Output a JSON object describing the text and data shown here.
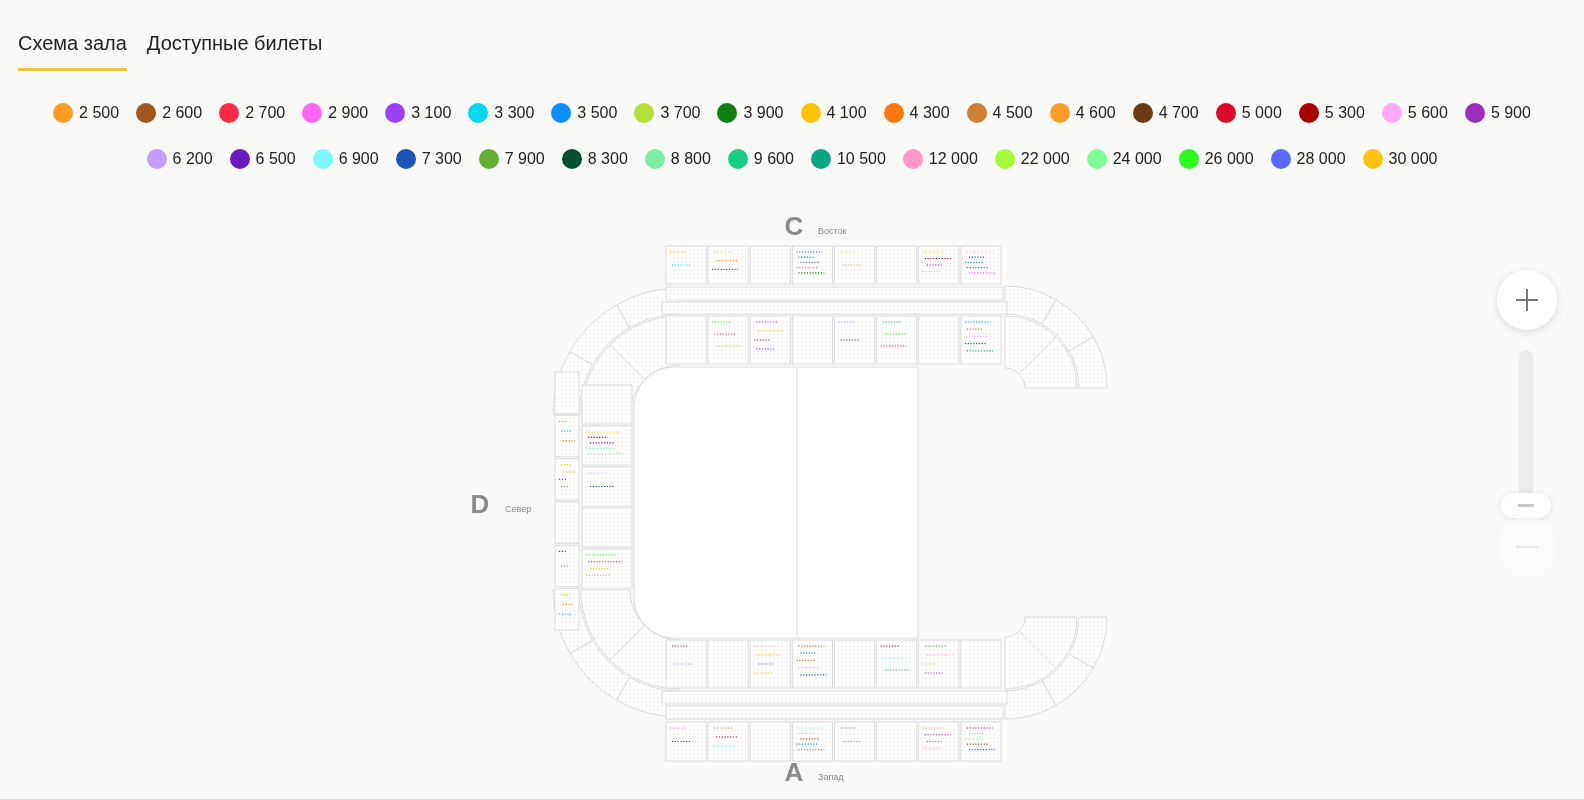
{
  "tabs": [
    {
      "label": "Схема зала",
      "selected": true
    },
    {
      "label": "Доступные билеты",
      "selected": false
    }
  ],
  "price_legend": [
    {
      "label": "2 500",
      "color": "#ff9a24"
    },
    {
      "label": "2 600",
      "color": "#a0561c"
    },
    {
      "label": "2 700",
      "color": "#ff2a45"
    },
    {
      "label": "2 900",
      "color": "#ff66f4"
    },
    {
      "label": "3 100",
      "color": "#9b42f8"
    },
    {
      "label": "3 300",
      "color": "#00d8f2"
    },
    {
      "label": "3 500",
      "color": "#0a8ffd"
    },
    {
      "label": "3 700",
      "color": "#b5e03a"
    },
    {
      "label": "3 900",
      "color": "#0f7f13"
    },
    {
      "label": "4 100",
      "color": "#ffc300"
    },
    {
      "label": "4 300",
      "color": "#ff760a"
    },
    {
      "label": "4 500",
      "color": "#cc7f34"
    },
    {
      "label": "4 600",
      "color": "#ff9c2a"
    },
    {
      "label": "4 700",
      "color": "#6c3a12"
    },
    {
      "label": "5 000",
      "color": "#dc0a2a"
    },
    {
      "label": "5 300",
      "color": "#a80000"
    },
    {
      "label": "5 600",
      "color": "#ffaaf8"
    },
    {
      "label": "5 900",
      "color": "#a02ebc"
    },
    {
      "label": "6 200",
      "color": "#c49dfc"
    },
    {
      "label": "6 500",
      "color": "#6a18bf"
    },
    {
      "label": "6 900",
      "color": "#7ef8fd"
    },
    {
      "label": "7 300",
      "color": "#1c54b7"
    },
    {
      "label": "7 900",
      "color": "#62ae30"
    },
    {
      "label": "8 300",
      "color": "#005030"
    },
    {
      "label": "8 800",
      "color": "#7deca0"
    },
    {
      "label": "9 600",
      "color": "#16cd88"
    },
    {
      "label": "10 500",
      "color": "#0aa684"
    },
    {
      "label": "12 000",
      "color": "#ff99c8"
    },
    {
      "label": "22 000",
      "color": "#a4fc38"
    },
    {
      "label": "24 000",
      "color": "#7efe98"
    },
    {
      "label": "26 000",
      "color": "#2bfb1f"
    },
    {
      "label": "28 000",
      "color": "#596bff"
    },
    {
      "label": "30 000",
      "color": "#ffc314"
    }
  ],
  "seat_map": {
    "stands": [
      {
        "kind": "top",
        "letter": "C",
        "name": "Восток"
      },
      {
        "kind": "left",
        "letter": "D",
        "name": "Север"
      },
      {
        "kind": "bottom",
        "letter": "A",
        "name": "Запад"
      }
    ]
  },
  "zoom": {
    "zoom_out_disabled": true
  }
}
